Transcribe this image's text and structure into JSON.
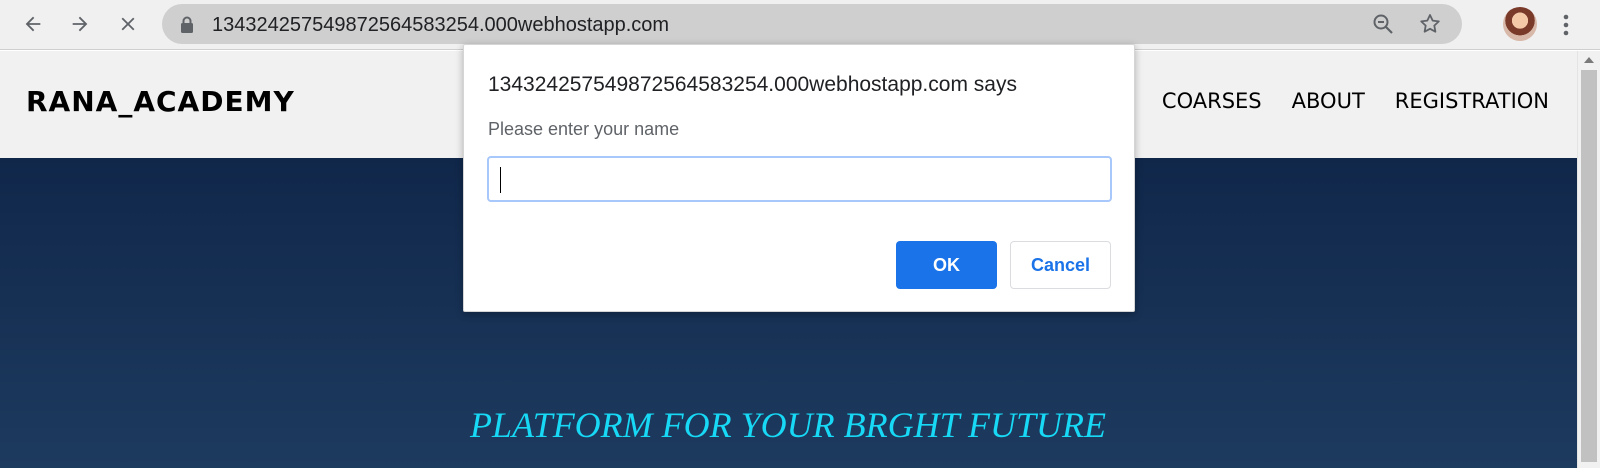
{
  "browser": {
    "url": "13432425754987256458325​4.000webhostapp.com",
    "icons": {
      "back": "arrow-left-icon",
      "forward": "arrow-right-icon",
      "stop": "close-icon",
      "lock": "lock-icon",
      "zoom": "zoom-out-icon",
      "bookmark": "star-icon",
      "profile": "avatar",
      "menu": "more-vertical-icon"
    }
  },
  "site": {
    "brand": "RANA_ACADEMY",
    "nav": {
      "courses": "COARSES",
      "about": "ABOUT",
      "registration": "REGISTRATION"
    },
    "tagline": "PLATFORM FOR YOUR BRGHT FUTURE",
    "colors": {
      "hero_top": "#10274a",
      "hero_bottom": "#1d3b5f",
      "tagline": "#17d8f5"
    }
  },
  "dialog": {
    "title": "1343242575498725645832​54.000webhostapp.com says",
    "message": "Please enter your name",
    "input_value": "",
    "ok_label": "OK",
    "cancel_label": "Cancel",
    "colors": {
      "primary": "#1a73e8"
    }
  }
}
